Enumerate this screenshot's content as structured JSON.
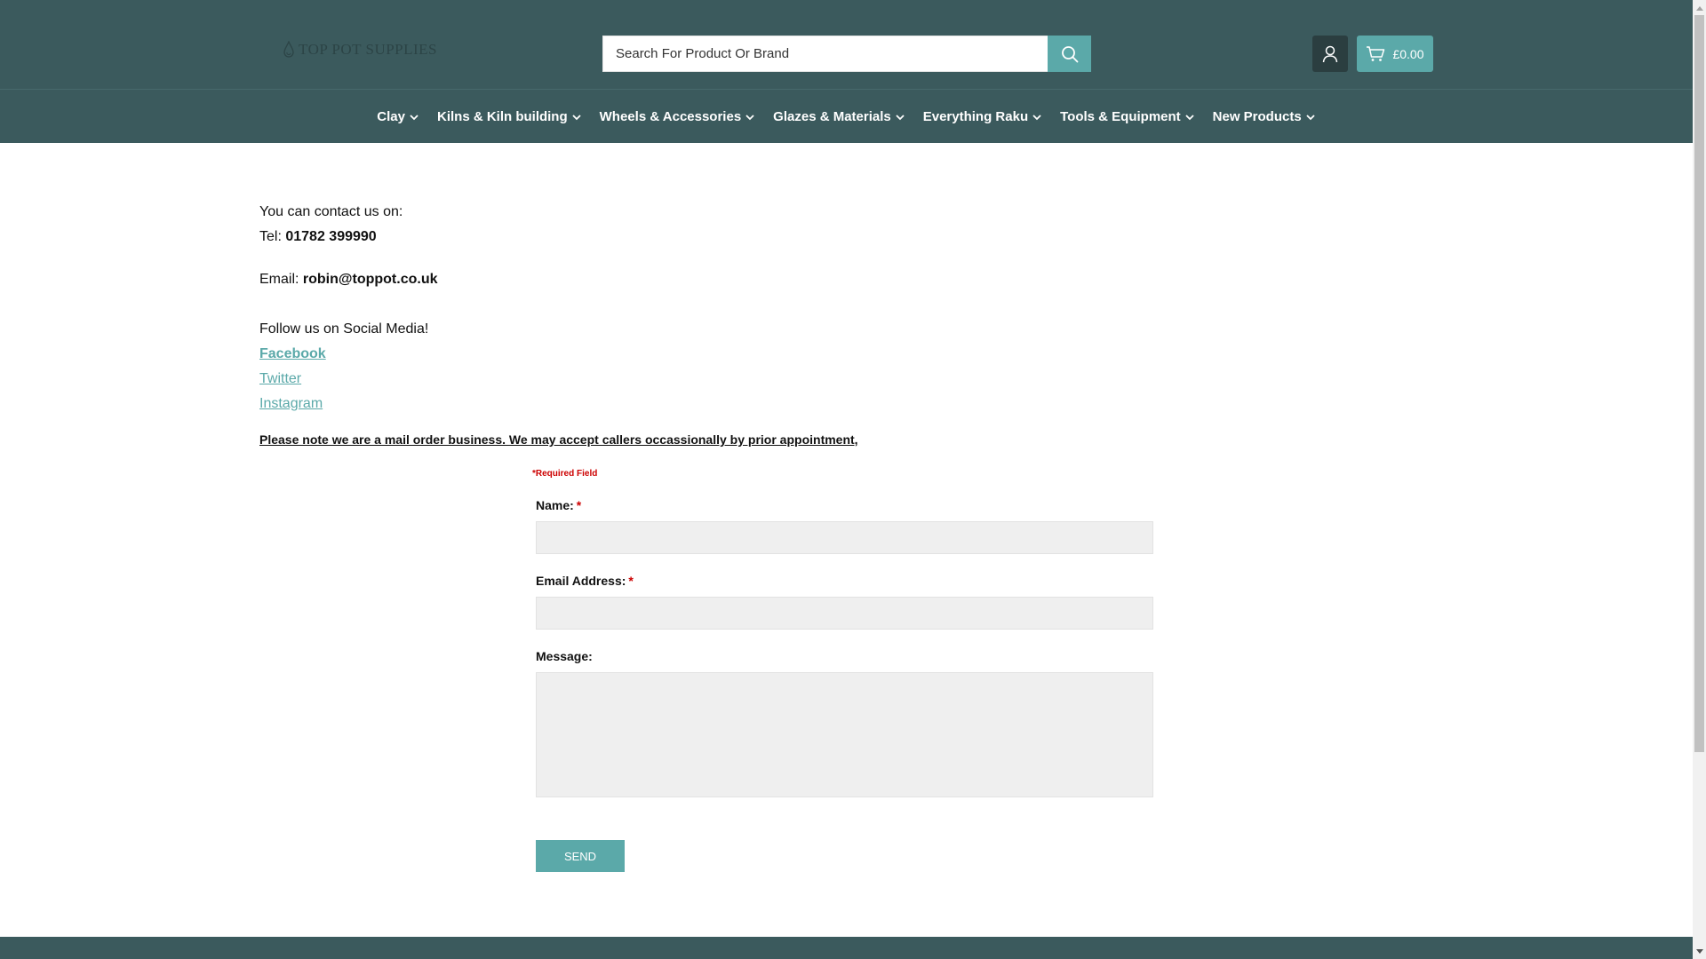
{
  "header": {
    "logo_text": "TOP POT SUPPLIES",
    "search": {
      "placeholder": "Search For Product Or Brand",
      "value": ""
    },
    "cart_total": "£0.00",
    "icons": {
      "search": "search-icon",
      "account": "user-icon",
      "cart": "cart-icon"
    },
    "colors": {
      "bar": "#3b5a5d",
      "accent": "#5ba9a9",
      "account_bg": "#2b3e40"
    }
  },
  "nav": {
    "items": [
      {
        "label": "Clay"
      },
      {
        "label": "Kilns & Kiln building"
      },
      {
        "label": "Wheels & Accessories"
      },
      {
        "label": "Glazes & Materials"
      },
      {
        "label": "Everything Raku"
      },
      {
        "label": "Tools & Equipment"
      },
      {
        "label": "New Products"
      }
    ]
  },
  "contact": {
    "intro": "You can contact us on:",
    "tel_label": "Tel:",
    "tel_value": "01782 399990",
    "email_label": "Email:",
    "email_value": "robin@toppot.co.uk",
    "social_heading": "Follow us on Social Media!",
    "social_links": [
      "Facebook",
      "Twitter",
      "Instagram"
    ],
    "notice": "Please note we are a mail order business. We may accept callers occassionally by prior appointment,"
  },
  "form": {
    "required_note": "*Required Field",
    "name_label": "Name:",
    "email_label": "Email Address:",
    "message_label": "Message:",
    "required_marker": "*",
    "send_label": "SEND"
  }
}
